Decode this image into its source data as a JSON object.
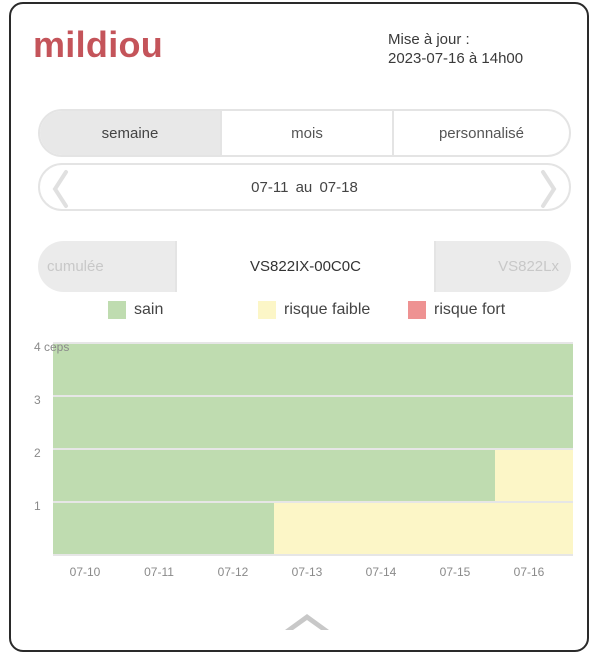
{
  "header": {
    "title": "mildiou",
    "update_label": "Mise à jour :",
    "update_value": "2023-07-16 à 14h00"
  },
  "period_tabs": [
    {
      "label": "semaine",
      "active": true
    },
    {
      "label": "mois",
      "active": false
    },
    {
      "label": "personnalisé",
      "active": false
    }
  ],
  "date_range": {
    "from": "07-11",
    "separator": "au",
    "to": "07-18",
    "prev_icon": "chevron-left-icon",
    "next_icon": "chevron-right-icon"
  },
  "sensors": {
    "left": "cumulée",
    "selected": "VS822IX-00C0C",
    "right": "VS822Lx"
  },
  "legend": [
    {
      "label": "sain",
      "color": "#bfdcb0"
    },
    {
      "label": "risque faible",
      "color": "#fcf6c7"
    },
    {
      "label": "risque fort",
      "color": "#ee9292"
    }
  ],
  "chart_data": {
    "type": "bar",
    "stacking": "horizontal-bands",
    "x_ticks": [
      "07-10",
      "07-11",
      "07-12",
      "07-13",
      "07-14",
      "07-15",
      "07-16"
    ],
    "y_ticks": [
      "1",
      "2",
      "3",
      "4 ceps"
    ],
    "rows": [
      {
        "cep": 1,
        "segments": [
          {
            "from": "07-10",
            "to": "07-12",
            "status": "sain"
          },
          {
            "from": "07-12",
            "to": "07-16",
            "status": "risque faible"
          }
        ]
      },
      {
        "cep": 2,
        "segments": [
          {
            "from": "07-10",
            "to": "07-15",
            "status": "sain"
          },
          {
            "from": "07-15",
            "to": "07-16",
            "status": "risque faible"
          }
        ]
      },
      {
        "cep": 3,
        "segments": [
          {
            "from": "07-10",
            "to": "07-16",
            "status": "sain"
          }
        ]
      },
      {
        "cep": 4,
        "segments": [
          {
            "from": "07-10",
            "to": "07-16",
            "status": "sain"
          }
        ]
      }
    ],
    "grid": true,
    "colors": {
      "sain": "#bfdcb0",
      "risque faible": "#fcf6c7",
      "risque fort": "#ee9292"
    }
  },
  "footer": {
    "collapse_icon": "chevron-up-icon"
  }
}
